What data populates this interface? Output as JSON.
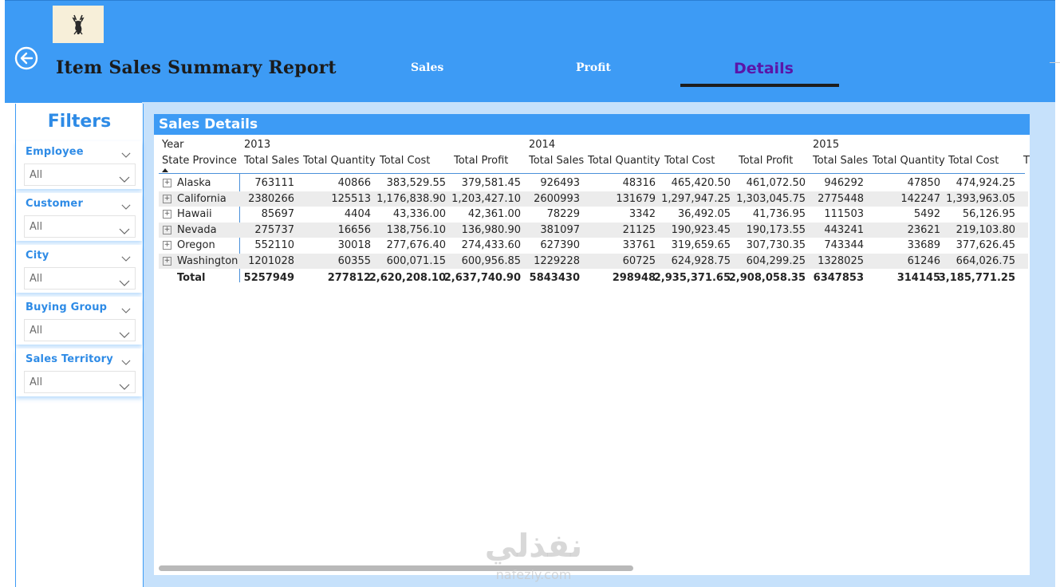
{
  "header": {
    "title": "Item Sales Summary Report",
    "tabs": [
      {
        "label": "Sales",
        "active": false
      },
      {
        "label": "Profit",
        "active": false
      },
      {
        "label": "Details",
        "active": true
      }
    ],
    "colors": {
      "header_bg": "#3d9bf5",
      "active_tab": "#5b16a8"
    }
  },
  "filters": {
    "title": "Filters",
    "items": [
      {
        "label": "Employee",
        "value": "All"
      },
      {
        "label": "Customer",
        "value": "All"
      },
      {
        "label": "City",
        "value": "All"
      },
      {
        "label": "Buying Group",
        "value": "All"
      },
      {
        "label": "Sales Territory",
        "value": "All"
      }
    ]
  },
  "table": {
    "title": "Sales Details",
    "row_header_top": "Year",
    "row_header_bottom": "State Province",
    "years": [
      "2013",
      "2014",
      "2015"
    ],
    "columns": [
      "Total Sales",
      "Total Quantity",
      "Total Cost",
      "Total Profit"
    ],
    "rows": [
      {
        "state": "Alaska",
        "values": [
          "763111",
          "40866",
          "383,529.55",
          "379,581.45",
          "926493",
          "48316",
          "465,420.50",
          "461,072.50",
          "946292",
          "47850",
          "474,924.25"
        ]
      },
      {
        "state": "California",
        "values": [
          "2380266",
          "125513",
          "1,176,838.90",
          "1,203,427.10",
          "2600993",
          "131679",
          "1,297,947.25",
          "1,303,045.75",
          "2775448",
          "142247",
          "1,393,963.05"
        ]
      },
      {
        "state": "Hawaii",
        "values": [
          "85697",
          "4404",
          "43,336.00",
          "42,361.00",
          "78229",
          "3342",
          "36,492.05",
          "41,736.95",
          "111503",
          "5492",
          "56,126.95"
        ]
      },
      {
        "state": "Nevada",
        "values": [
          "275737",
          "16656",
          "138,756.10",
          "136,980.90",
          "381097",
          "21125",
          "190,923.45",
          "190,173.55",
          "443241",
          "23621",
          "219,103.80"
        ]
      },
      {
        "state": "Oregon",
        "values": [
          "552110",
          "30018",
          "277,676.40",
          "274,433.60",
          "627390",
          "33761",
          "319,659.65",
          "307,730.35",
          "743344",
          "33689",
          "377,626.45"
        ]
      },
      {
        "state": "Washington",
        "values": [
          "1201028",
          "60355",
          "600,071.15",
          "600,956.85",
          "1229228",
          "60725",
          "624,928.75",
          "604,299.25",
          "1328025",
          "61246",
          "664,026.75"
        ]
      }
    ],
    "total": {
      "label": "Total",
      "values": [
        "5257949",
        "277812",
        "2,620,208.10",
        "2,637,740.90",
        "5843430",
        "298948",
        "2,935,371.65",
        "2,908,058.35",
        "6347853",
        "314145",
        "3,185,771.25"
      ]
    }
  },
  "watermark": {
    "text": "نفذلي",
    "sub": "nafezly.com"
  }
}
